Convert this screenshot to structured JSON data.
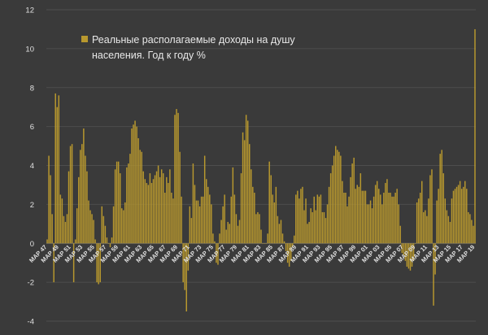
{
  "chart_data": {
    "type": "bar",
    "legend": {
      "position": "top-left",
      "line1": "Реальные располагаемые доходы на душу",
      "line2": "населения. Год к году %"
    },
    "series": [
      {
        "name": "Реальные располагаемые доходы на душу населения. Год к году %",
        "color": "#b8982e"
      }
    ],
    "ylim": [
      -4,
      12
    ],
    "yticks": [
      -4,
      -2,
      0,
      2,
      4,
      6,
      8,
      10,
      12
    ],
    "grid": true,
    "grid_axis": "y",
    "x_start_year": 1947,
    "x_end_year": 2019,
    "x_step": "quarter",
    "x_tick_labels": [
      "MAP 47",
      "MAP 49",
      "MAP 51",
      "MAP 53",
      "MAP 55",
      "MAP 57",
      "MAP 59",
      "MAP 61",
      "MAP 63",
      "MAP 65",
      "MAP 67",
      "MAP 69",
      "MAP 71",
      "MAP 73",
      "MAP 75",
      "MAP 77",
      "MAP 79",
      "MAP 81",
      "MAP 83",
      "MAP 85",
      "MAP 87",
      "MAP 89",
      "MAP 91",
      "MAP 93",
      "MAP 95",
      "MAP 97",
      "MAP 99",
      "MAP 01",
      "MAP 03",
      "MAP 05",
      "MAP 07",
      "MAP 09",
      "MAP 11",
      "MAP 13",
      "MAP 15",
      "MAP 17",
      "MAP 19"
    ],
    "values": [
      0.2,
      4.5,
      3.5,
      1.5,
      -2.0,
      7.7,
      7.0,
      7.6,
      2.5,
      2.3,
      1.4,
      1.1,
      1.5,
      3.7,
      5.0,
      5.1,
      -2.0,
      0.2,
      1.8,
      3.4,
      4.8,
      5.1,
      5.9,
      4.5,
      3.7,
      2.2,
      1.7,
      1.5,
      1.2,
      0.2,
      -2.0,
      -2.1,
      -2.0,
      1.9,
      1.4,
      0.9,
      0.3,
      0.0,
      -0.2,
      0.3,
      1.9,
      3.8,
      4.2,
      4.2,
      3.6,
      1.8,
      1.7,
      2.1,
      3.9,
      4.1,
      4.6,
      5.9,
      6.1,
      6.3,
      6.0,
      5.4,
      4.8,
      4.7,
      3.7,
      3.3,
      3.1,
      3.0,
      3.6,
      3.1,
      3.3,
      3.5,
      3.7,
      4.0,
      3.4,
      3.8,
      3.6,
      2.6,
      3.4,
      3.1,
      3.8,
      2.6,
      2.3,
      6.6,
      6.9,
      6.7,
      4.7,
      2.4,
      -2.0,
      -2.4,
      -3.5,
      -1.4,
      1.9,
      1.3,
      4.1,
      3.0,
      2.2,
      2.2,
      1.9,
      2.4,
      2.4,
      4.5,
      3.3,
      2.9,
      2.5,
      2.0,
      0.5,
      0.1,
      -1.0,
      -1.1,
      0.5,
      1.2,
      1.9,
      2.5,
      0.7,
      1.1,
      1.0,
      2.4,
      3.9,
      2.5,
      1.5,
      0.9,
      1.2,
      3.6,
      5.7,
      5.3,
      6.6,
      6.3,
      5.1,
      3.8,
      2.9,
      2.6,
      1.5,
      1.6,
      1.5,
      0.7,
      0.0,
      0.0,
      0.0,
      0.5,
      4.2,
      3.5,
      2.5,
      2.1,
      2.9,
      1.4,
      1.0,
      1.2,
      0.5,
      0.1,
      -0.4,
      -1.0,
      -1.2,
      -0.9,
      -0.2,
      0.4,
      2.5,
      2.7,
      2.3,
      2.8,
      2.9,
      1.7,
      2.3,
      1.0,
      1.1,
      1.8,
      1.6,
      2.4,
      1.7,
      2.5,
      2.4,
      2.5,
      1.6,
      1.6,
      1.3,
      2.0,
      2.9,
      3.6,
      4.0,
      4.5,
      5.0,
      4.8,
      4.7,
      4.5,
      3.2,
      2.6,
      2.6,
      1.9,
      2.4,
      3.4,
      4.1,
      4.4,
      2.8,
      3.0,
      2.9,
      3.6,
      2.7,
      2.7,
      2.7,
      2.0,
      2.0,
      2.2,
      1.8,
      2.4,
      3.0,
      3.2,
      2.8,
      2.5,
      2.0,
      2.6,
      3.1,
      3.3,
      2.6,
      2.6,
      2.4,
      2.4,
      2.6,
      2.8,
      2.0,
      0.9,
      -0.5,
      -0.6,
      -0.9,
      -1.2,
      -1.3,
      -1.4,
      -1.2,
      -0.9,
      0.0,
      2.1,
      2.3,
      2.6,
      3.2,
      1.6,
      1.7,
      1.4,
      2.3,
      3.5,
      3.8,
      -3.2,
      -1.6,
      2.2,
      2.8,
      4.6,
      4.8,
      3.6,
      2.3,
      1.7,
      1.4,
      1.1,
      2.3,
      2.7,
      2.8,
      2.9,
      3.0,
      3.2,
      2.8,
      2.9,
      3.2,
      2.8,
      1.6,
      1.5,
      1.2,
      0.9,
      11.0
    ]
  }
}
